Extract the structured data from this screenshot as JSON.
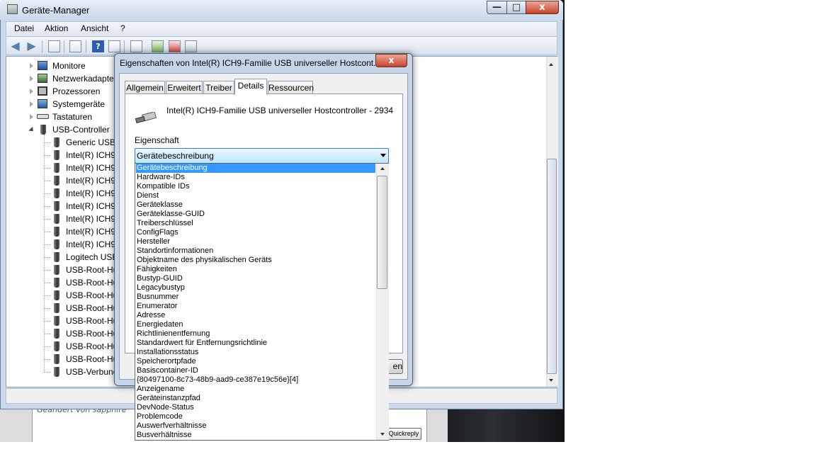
{
  "main_window": {
    "title": "Geräte-Manager",
    "menu": [
      "Datei",
      "Aktion",
      "Ansicht",
      "?"
    ]
  },
  "tree": {
    "categories": [
      {
        "label": "Monitore",
        "icon": "monitor-icon"
      },
      {
        "label": "Netzwerkadapter",
        "icon": "network-adapter-icon"
      },
      {
        "label": "Prozessoren",
        "icon": "processor-icon"
      },
      {
        "label": "Systemgeräte",
        "icon": "system-device-icon"
      },
      {
        "label": "Tastaturen",
        "icon": "keyboard-icon"
      },
      {
        "label": "USB-Controller",
        "icon": "usb-icon"
      }
    ],
    "usb_children": [
      "Generic USB",
      "Intel(R) ICH9",
      "Intel(R) ICH9",
      "Intel(R) ICH9",
      "Intel(R) ICH9",
      "Intel(R) ICH9",
      "Intel(R) ICH9",
      "Intel(R) ICH9",
      "Intel(R) ICH9",
      "Logitech USB",
      "USB-Root-Hu",
      "USB-Root-Hu",
      "USB-Root-Hu",
      "USB-Root-Hu",
      "USB-Root-Hu",
      "USB-Root-Hu",
      "USB-Root-Hu",
      "USB-Root-Hu",
      "USB-Verbund"
    ]
  },
  "dialog": {
    "title": "Eigenschaften von Intel(R) ICH9-Familie USB universeller Hostcont...",
    "close_label": "x",
    "tabs": [
      "Allgemein",
      "Erweitert",
      "Treiber",
      "Details",
      "Ressourcen"
    ],
    "active_tab": "Details",
    "device_name": "Intel(R) ICH9-Familie USB universeller Hostcontroller - 2934",
    "property_label": "Eigenschaft",
    "property_selected": "Gerätebeschreibung",
    "button_partial": "en",
    "dropdown_options": [
      "Gerätebeschreibung",
      "Hardware-IDs",
      "Kompatible IDs",
      "Dienst",
      "Geräteklasse",
      "Geräteklasse-GUID",
      "Treiberschlüssel",
      "ConfigFlags",
      "Hersteller",
      "Standortinformationen",
      "Objektname des physikalischen Geräts",
      "Fähigkeiten",
      "Bustyp-GUID",
      "Legacybustyp",
      "Busnummer",
      "Enumerator",
      "Adresse",
      "Energiedaten",
      "Richtlinienentfernung",
      "Standardwert für Entfernungsrichtlinie",
      "Installationsstatus",
      "Speicherortpfade",
      "Basiscontainer-ID",
      "{80497100-8c73-48b9-aad9-ce387e19c56e}[4]",
      "Anzeigename",
      "Geräteinstanzpfad",
      "DevNode-Status",
      "Problemcode",
      "Auswerfverhältnisse",
      "Busverhältnisse"
    ]
  },
  "background": {
    "post_text": "Geändert von sapphire",
    "quickreply_label": "Quickreply"
  },
  "colors": {
    "selection": "#3399ff",
    "window_frame": "#c9d8ea",
    "close_button": "#c7432b"
  }
}
